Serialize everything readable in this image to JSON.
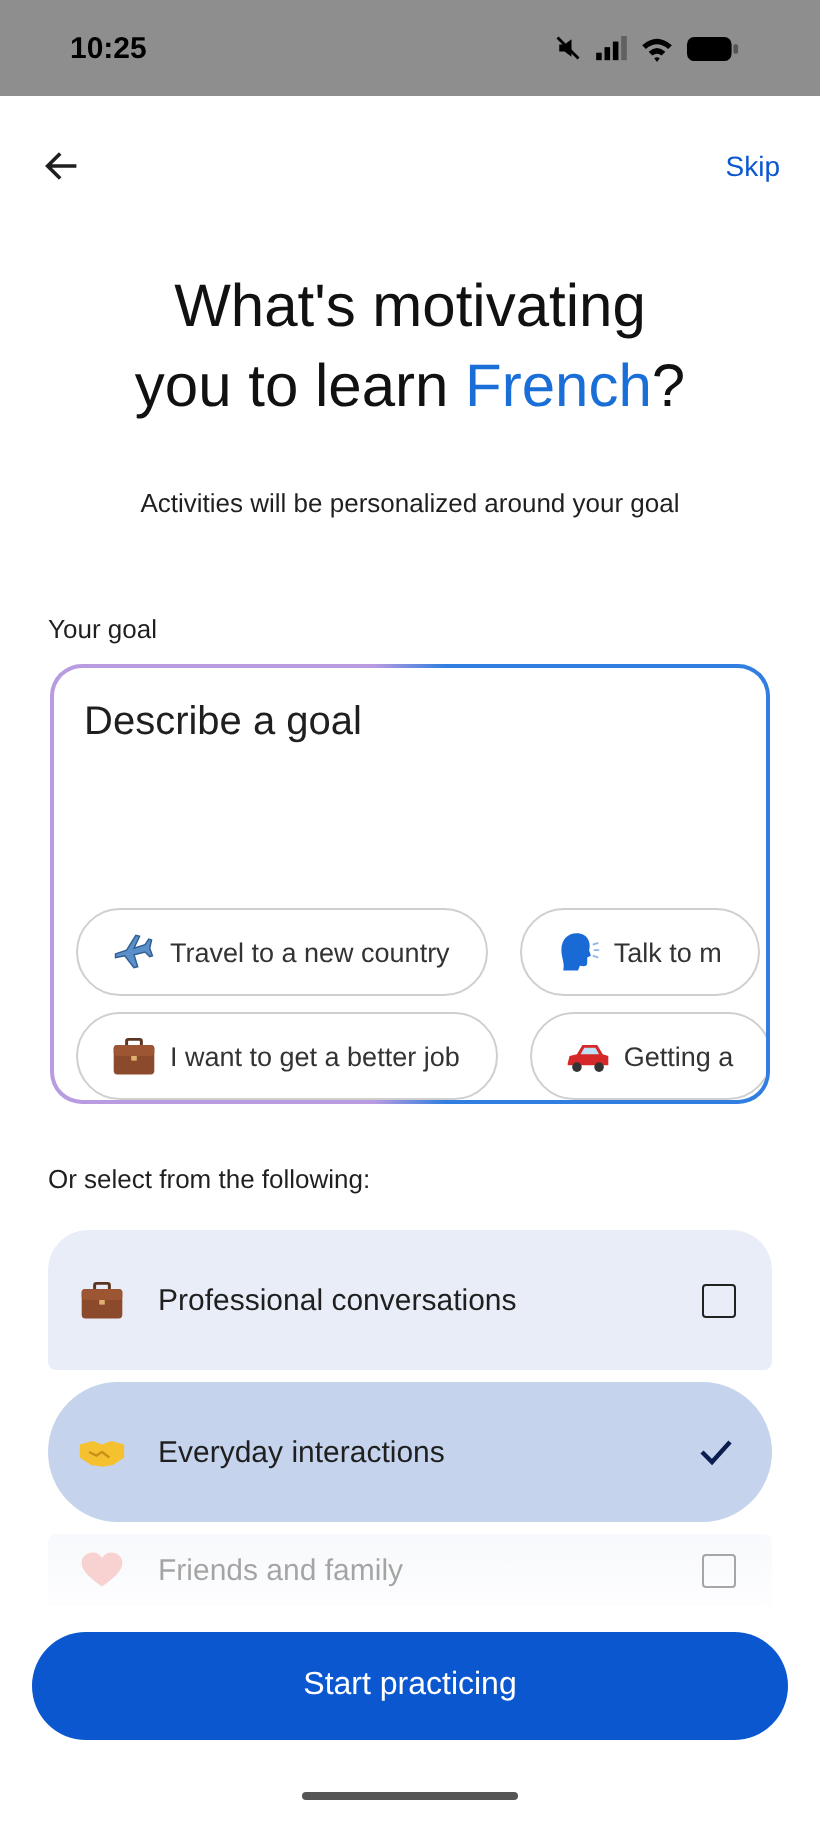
{
  "status_bar": {
    "time": "10:25"
  },
  "header": {
    "skip": "Skip"
  },
  "title": {
    "before": "What's motivating you to learn ",
    "highlight": "French",
    "after": "?"
  },
  "subtitle": "Activities will be personalized around your goal",
  "goal": {
    "label": "Your goal",
    "placeholder": "Describe a goal",
    "chip_rows": [
      [
        {
          "kind": "plane",
          "label": "Travel to a new country"
        },
        {
          "kind": "speaker",
          "label": "Talk to m"
        }
      ],
      [
        {
          "kind": "briefcase",
          "label": "I want to get a better job"
        },
        {
          "kind": "car",
          "label": "Getting a"
        }
      ]
    ]
  },
  "options_label": "Or select from the following:",
  "options": [
    {
      "kind": "briefcase",
      "label": "Professional conversations",
      "selected": false
    },
    {
      "kind": "handshake",
      "label": "Everyday interactions",
      "selected": true
    },
    {
      "kind": "heart",
      "label": "Friends and family",
      "selected": false
    }
  ],
  "button": "Start practicing"
}
